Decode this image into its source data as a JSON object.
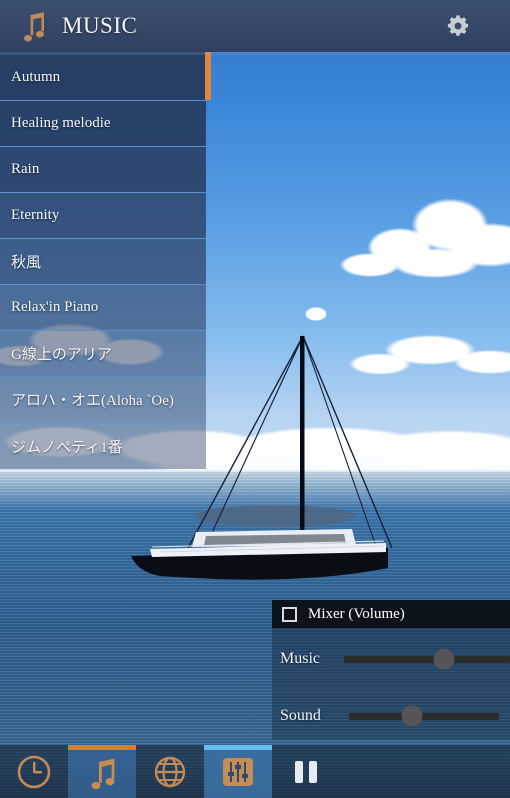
{
  "header": {
    "title": "MUSIC",
    "logo_icon": "music-note-icon",
    "settings_icon": "gear-icon"
  },
  "tracklist": {
    "items": [
      {
        "label": "Autumn",
        "selected": true
      },
      {
        "label": "Healing melodie",
        "selected": false
      },
      {
        "label": "Rain",
        "selected": false
      },
      {
        "label": "Eternity",
        "selected": false
      },
      {
        "label": "秋風",
        "selected": false
      },
      {
        "label": "Relax'in Piano",
        "selected": false
      },
      {
        "label": "G線上のアリア",
        "selected": false
      },
      {
        "label": "アロハ・オエ(Aloha `Oe)",
        "selected": false
      },
      {
        "label": "ジムノペティ1番",
        "selected": false
      }
    ],
    "scrollbar_color": "#e0873b"
  },
  "mixer": {
    "title": "Mixer  (Volume)",
    "checkbox_checked": false,
    "sliders": [
      {
        "label": "Music",
        "value": 60
      },
      {
        "label": "Sound",
        "value": 42
      }
    ]
  },
  "toolbar": {
    "items": [
      {
        "name": "clock",
        "icon": "clock-icon",
        "active": false,
        "indicator": "none"
      },
      {
        "name": "music",
        "icon": "music-note-icon",
        "active": true,
        "indicator": "orange"
      },
      {
        "name": "web",
        "icon": "globe-icon",
        "active": false,
        "indicator": "none"
      },
      {
        "name": "mixer",
        "icon": "equalizer-icon",
        "active": true,
        "indicator": "blue"
      },
      {
        "name": "pause",
        "icon": "pause-icon",
        "active": false,
        "indicator": "none"
      }
    ]
  },
  "colors": {
    "accent_orange": "#e0783a",
    "accent_blue": "#63bdf0",
    "header_bg": "#36476a",
    "list_bg": "#283c60"
  },
  "background": {
    "scene": "sailboat-on-sea-with-clouds"
  }
}
